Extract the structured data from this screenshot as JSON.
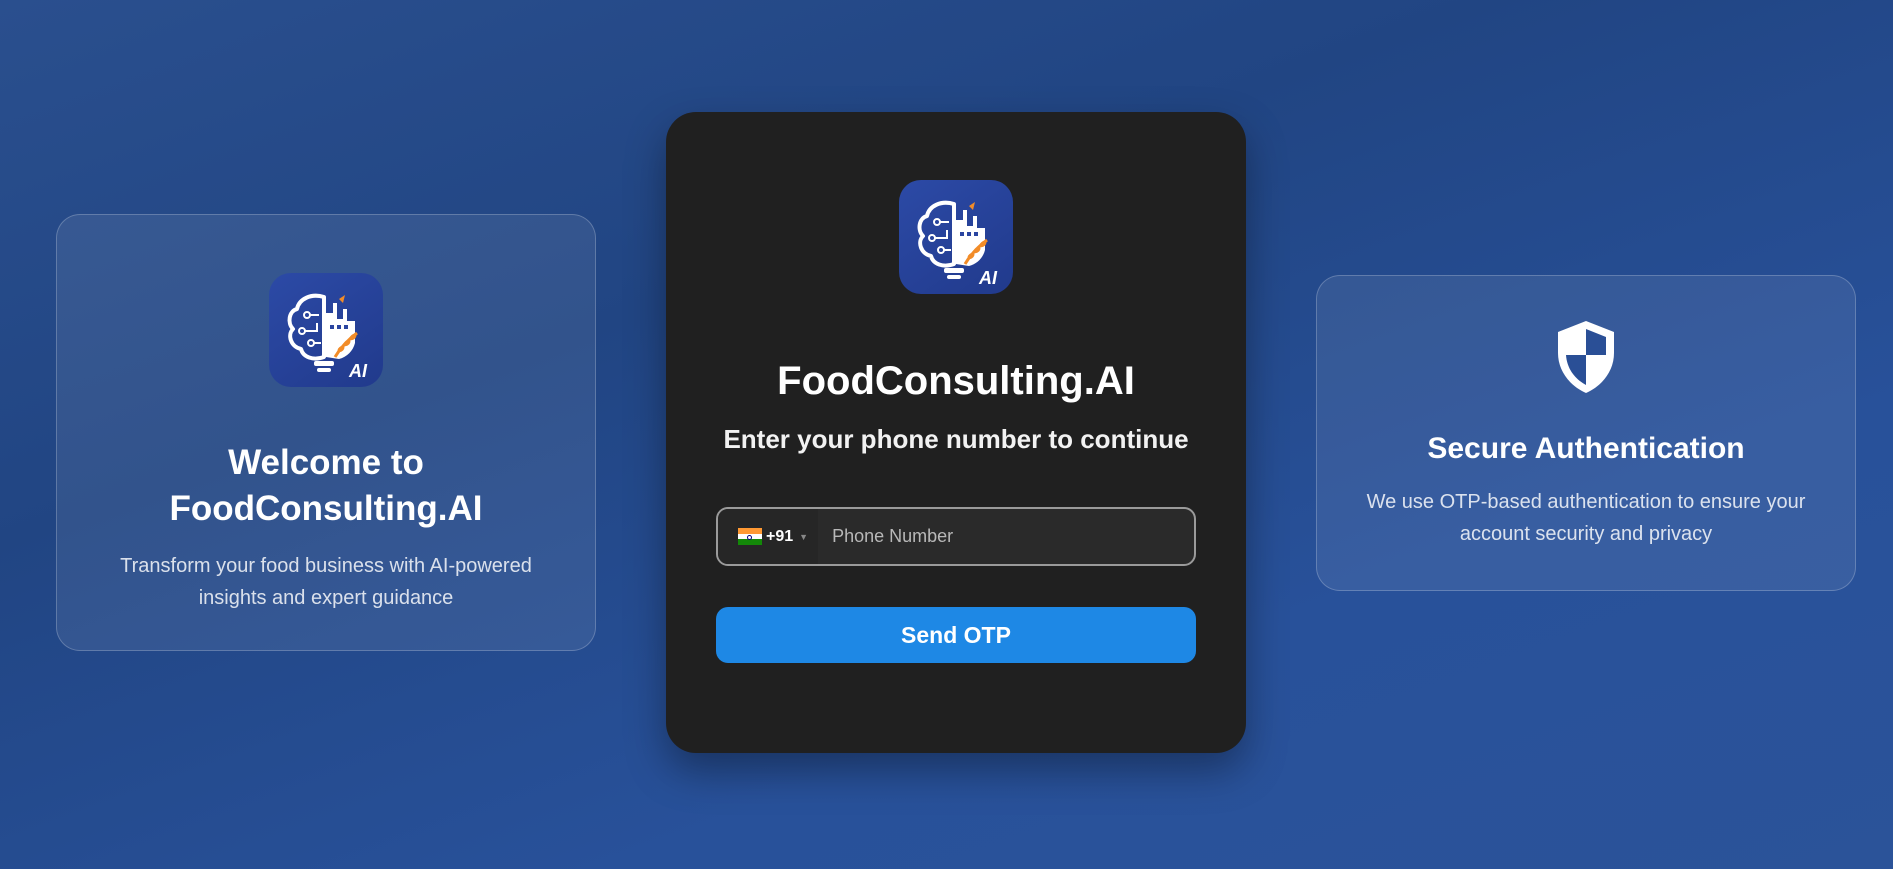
{
  "colors": {
    "accent": "#1e88e5",
    "card_dark": "#202020",
    "background": "#214583"
  },
  "welcome_card": {
    "logo_badge": "AI",
    "title_line1": "Welcome to",
    "title_line2": "FoodConsulting.AI",
    "description": "Transform your food business with AI-powered insights and expert guidance"
  },
  "login_card": {
    "logo_badge": "AI",
    "title": "FoodConsulting.AI",
    "subtitle": "Enter your phone number to continue",
    "phone": {
      "country_flag": "india-flag-icon",
      "dial_code": "+91",
      "placeholder": "Phone Number",
      "value": ""
    },
    "send_button_label": "Send OTP"
  },
  "security_card": {
    "icon": "shield-icon",
    "title": "Secure Authentication",
    "description": "We use OTP-based authentication to ensure your account security and privacy"
  }
}
